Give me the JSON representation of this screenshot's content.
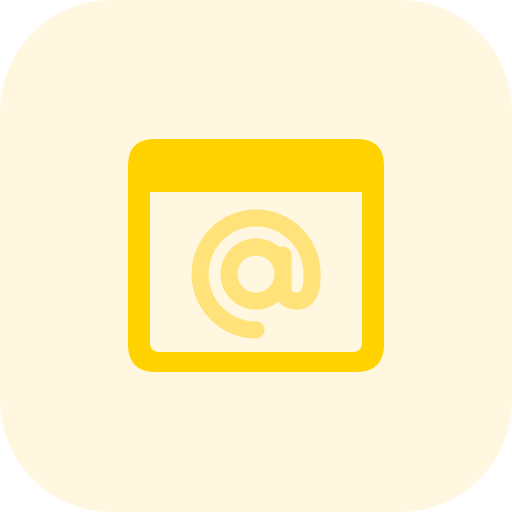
{
  "icon": {
    "name": "browser-at-icon",
    "background_color": "#fff7df",
    "frame_color": "#ffd200",
    "at_symbol_color": "#ffe27a"
  }
}
